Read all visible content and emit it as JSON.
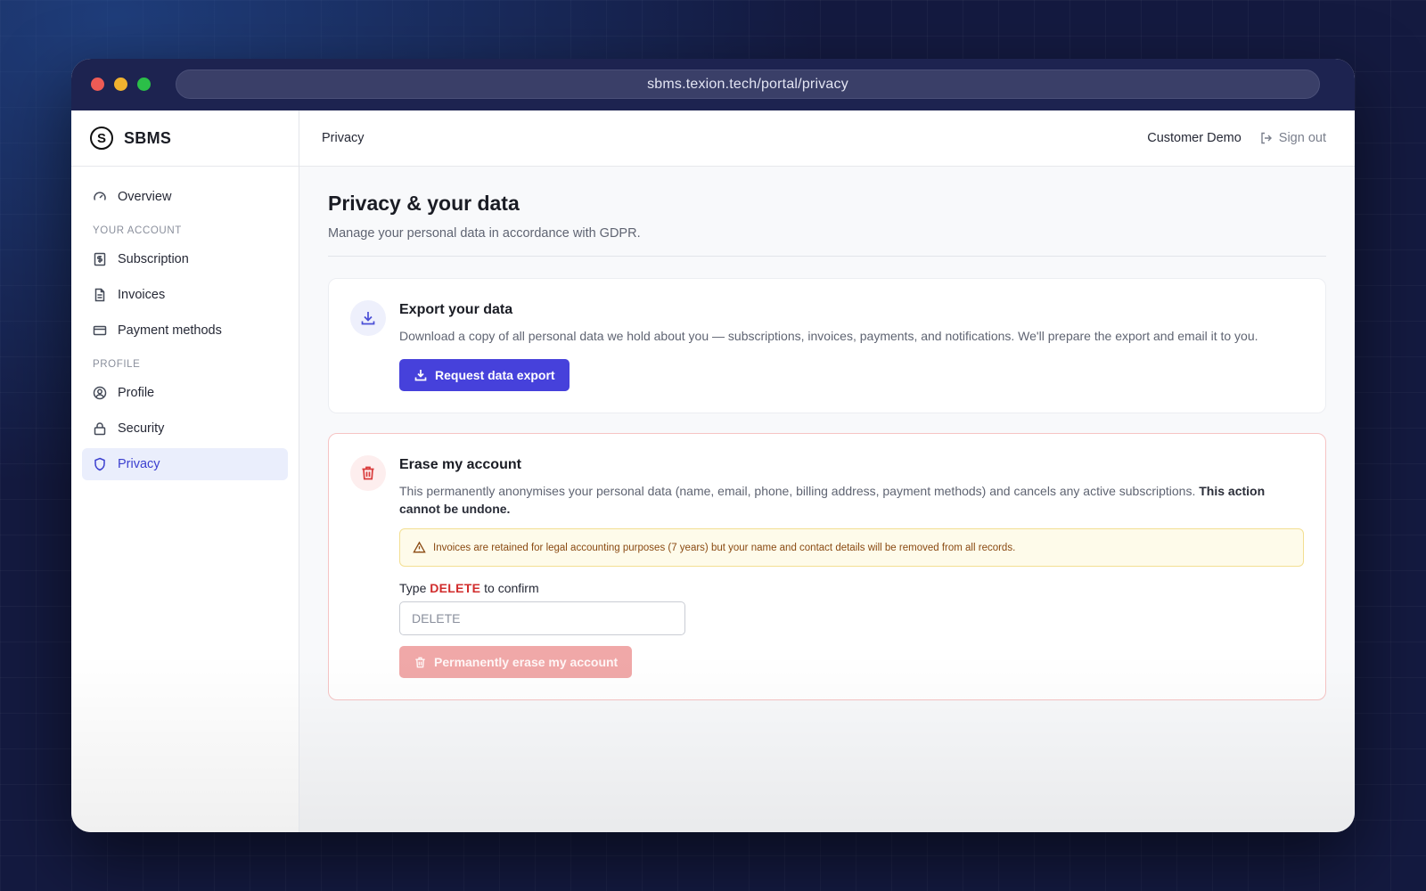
{
  "browser": {
    "url": "sbms.texion.tech/portal/privacy"
  },
  "brand": {
    "logo_letter": "S",
    "name": "SBMS"
  },
  "sidebar": {
    "top_items": [
      {
        "label": "Overview",
        "icon": "gauge-icon"
      }
    ],
    "sections": [
      {
        "title": "YOUR ACCOUNT",
        "items": [
          {
            "label": "Subscription",
            "icon": "dollar-receipt-icon"
          },
          {
            "label": "Invoices",
            "icon": "document-icon"
          },
          {
            "label": "Payment methods",
            "icon": "credit-card-icon"
          }
        ]
      },
      {
        "title": "PROFILE",
        "items": [
          {
            "label": "Profile",
            "icon": "user-circle-icon"
          },
          {
            "label": "Security",
            "icon": "lock-icon"
          },
          {
            "label": "Privacy",
            "icon": "shield-icon",
            "active": true
          }
        ]
      }
    ]
  },
  "topbar": {
    "breadcrumb": "Privacy",
    "user_name": "Customer Demo",
    "signout_label": "Sign out"
  },
  "page": {
    "title": "Privacy & your data",
    "subtitle": "Manage your personal data in accordance with GDPR."
  },
  "export_card": {
    "title": "Export your data",
    "description": "Download a copy of all personal data we hold about you — subscriptions, invoices, payments, and notifications. We'll prepare the export and email it to you.",
    "button_label": "Request data export"
  },
  "erase_card": {
    "title": "Erase my account",
    "description": "This permanently anonymises your personal data (name, email, phone, billing address, payment methods) and cancels any active subscriptions.",
    "description_bold": "This action cannot be undone.",
    "warning": "Invoices are retained for legal accounting purposes (7 years) but your name and contact details will be removed from all records.",
    "confirm_prefix": "Type",
    "confirm_keyword": "DELETE",
    "confirm_suffix": "to confirm",
    "input_placeholder": "DELETE",
    "input_value": "",
    "button_label": "Permanently erase my account"
  },
  "colors": {
    "accent": "#4641db",
    "danger": "#d12c2c",
    "danger_disabled": "#f0a8a8",
    "warning_bg": "#fefbea",
    "active_nav_bg": "#eaeefc"
  }
}
